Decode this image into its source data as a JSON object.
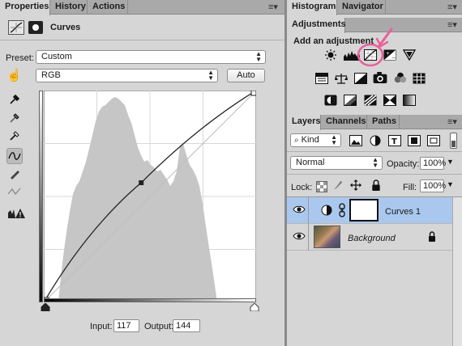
{
  "properties_panel": {
    "tabs": [
      {
        "label": "Properties"
      },
      {
        "label": "History"
      },
      {
        "label": "Actions"
      }
    ],
    "header_title": "Curves",
    "preset_label": "Preset:",
    "preset_value": "Custom",
    "channel_value": "RGB",
    "auto_label": "Auto",
    "input_label": "Input:",
    "input_value": "117",
    "output_label": "Output:",
    "output_value": "144",
    "curve_point": {
      "input": 117,
      "output": 144
    },
    "range": [
      0,
      255
    ]
  },
  "right_top": {
    "tabs": [
      {
        "label": "Histogram"
      },
      {
        "label": "Navigator"
      }
    ]
  },
  "adjustments": {
    "tab_label": "Adjustments",
    "add_label": "Add an adjustment",
    "row1": [
      "brightness-contrast-icon",
      "levels-icon",
      "curves-icon",
      "exposure-icon",
      "vibrance-icon"
    ],
    "row2": [
      "hue-saturation-icon",
      "color-balance-icon",
      "black-white-icon",
      "photo-filter-icon",
      "channel-mixer-icon",
      "color-lookup-icon"
    ],
    "row3": [
      "invert-icon",
      "posterize-icon",
      "threshold-icon",
      "selective-color-icon",
      "gradient-map-icon"
    ],
    "highlight_color": "#e8609a"
  },
  "layers_panel": {
    "tabs": [
      {
        "label": "Layers"
      },
      {
        "label": "Channels"
      },
      {
        "label": "Paths"
      }
    ],
    "kind_label": "Kind",
    "blend_mode": "Normal",
    "opacity_label": "Opacity:",
    "opacity_value": "100%",
    "lock_label": "Lock:",
    "fill_label": "Fill:",
    "fill_value": "100%",
    "layers": [
      {
        "name": "Curves 1",
        "selected": true
      },
      {
        "name": "Background",
        "selected": false
      }
    ]
  },
  "colors": {
    "panel": "#d6d6d6",
    "tabbar": "#a9a9a9",
    "selected_layer": "#aac8ee"
  }
}
